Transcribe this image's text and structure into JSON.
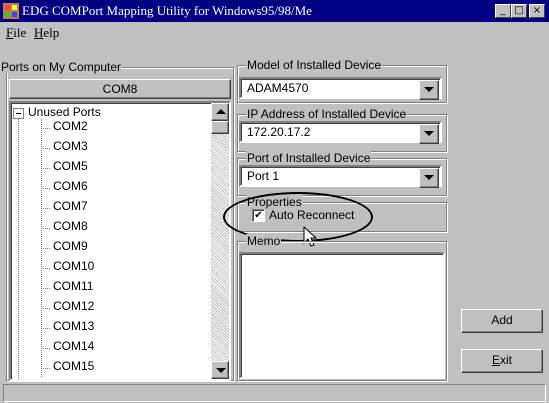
{
  "window": {
    "title": "EDG COMPort Mapping Utility for Windows95/98/Me",
    "icon": "app-icon",
    "min_glyph": "_",
    "max_glyph": "□",
    "close_glyph": "×"
  },
  "menu": {
    "file": "File",
    "help": "Help"
  },
  "ports_group": {
    "label": "Ports on My Computer",
    "selected_port": "COM8",
    "tree_root": "Unused Ports",
    "tree_root_toggle": "⊟",
    "items": [
      "COM2",
      "COM3",
      "COM5",
      "COM6",
      "COM7",
      "COM8",
      "COM9",
      "COM10",
      "COM11",
      "COM12",
      "COM13",
      "COM14",
      "COM15"
    ]
  },
  "model": {
    "label": "Model of Installed Device",
    "value": "ADAM4570"
  },
  "ip": {
    "label": "IP Address of Installed Device",
    "value": "172.20.17.2"
  },
  "port": {
    "label": "Port of Installed Device",
    "value": "Port 1"
  },
  "properties": {
    "label": "Properties",
    "auto_reconnect_label": "Auto Reconnect",
    "auto_reconnect_checked": true,
    "check_glyph": "✔"
  },
  "memo": {
    "label": "Memo",
    "value": ""
  },
  "buttons": {
    "add": "Add",
    "exit": "Exit"
  },
  "colors": {
    "titlebar": "#000080",
    "face": "#c0c0c0",
    "highlight_annotation": "#000000"
  }
}
